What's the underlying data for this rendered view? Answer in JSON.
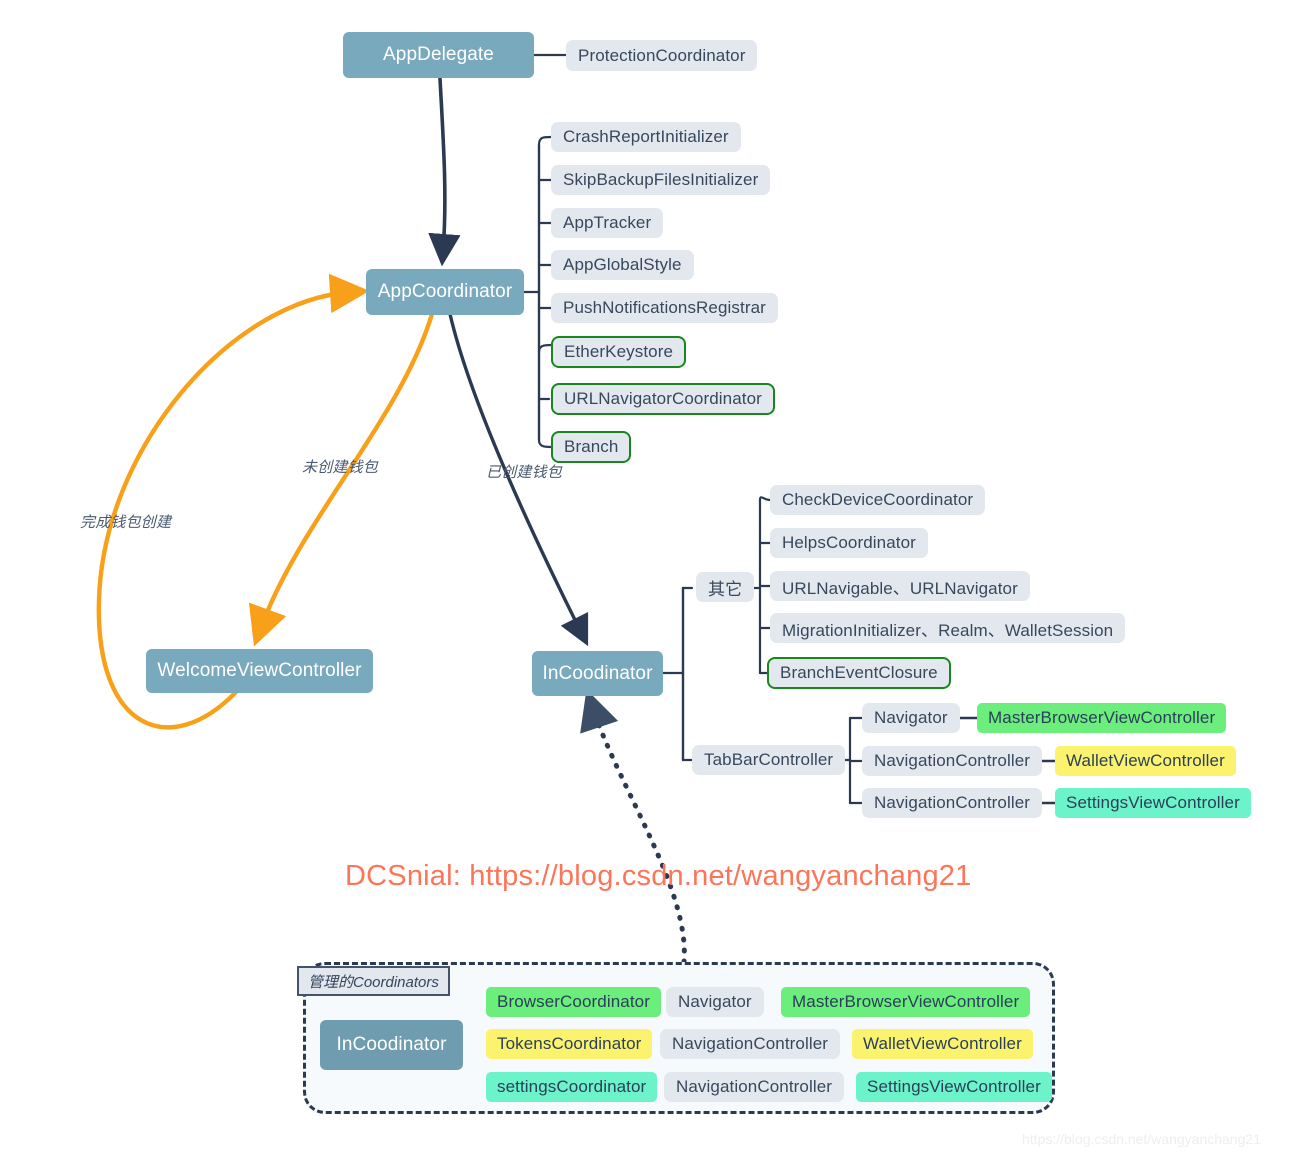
{
  "diagram": {
    "title": "AppDelegate coordinator architecture",
    "colors": {
      "teal": "#79a9bc",
      "teal_dark": "#6f9cae",
      "plain_fill": "#e3e8ef",
      "green_outline": "#18871d",
      "green_fill": "#6bee7c",
      "yellow_fill": "#fbf36e",
      "mint_fill": "#6df3c9",
      "line": "#2b3a52",
      "orange": "#f8a019",
      "watermark": "#fd7558"
    }
  },
  "nodes": {
    "app_delegate": "AppDelegate",
    "protection_coordinator": "ProtectionCoordinator",
    "app_coordinator": "AppCoordinator",
    "crash_report_initializer": "CrashReportInitializer",
    "skip_backup_files_initializer": "SkipBackupFilesInitializer",
    "app_tracker": "AppTracker",
    "app_global_style": "AppGlobalStyle",
    "push_notifications_registrar": "PushNotificationsRegistrar",
    "ether_keystore": "EtherKeystore",
    "url_navigator_coordinator": "URLNavigatorCoordinator",
    "branch": "Branch",
    "welcome_view_controller": "WelcomeViewController",
    "in_coodinator": "InCoodinator",
    "other_group": "其它",
    "check_device_coordinator": "CheckDeviceCoordinator",
    "helps_coordinator": "HelpsCoordinator",
    "url_navigable": "URLNavigable、URLNavigator",
    "migration_initializer": "MigrationInitializer、Realm、WalletSession",
    "branch_event_closure": "BranchEventClosure",
    "tab_bar_controller": "TabBarController",
    "navigator": "Navigator",
    "navigation_controller_1": "NavigationController",
    "navigation_controller_2": "NavigationController",
    "master_browser_view_controller": "MasterBrowserViewController",
    "wallet_view_controller": "WalletViewController",
    "settings_view_controller": "SettingsViewController"
  },
  "edge_labels": {
    "wallet_created": "已创建钱包",
    "wallet_not_created": "未创建钱包",
    "wallet_creation_finished": "完成钱包创建"
  },
  "group": {
    "label": "管理的Coordinators",
    "root": "InCoodinator",
    "rows": [
      {
        "coordinator": "BrowserCoordinator",
        "nav": "Navigator",
        "vc": "MasterBrowserViewController"
      },
      {
        "coordinator": "TokensCoordinator",
        "nav": "NavigationController",
        "vc": "WalletViewController"
      },
      {
        "coordinator": "settingsCoordinator",
        "nav": "NavigationController",
        "vc": "SettingsViewController"
      }
    ]
  },
  "watermarks": {
    "main": "DCSnial: https://blog.csdn.net/wangyanchang21",
    "corner": "https://blog.csdn.net/wangyanchang21"
  }
}
